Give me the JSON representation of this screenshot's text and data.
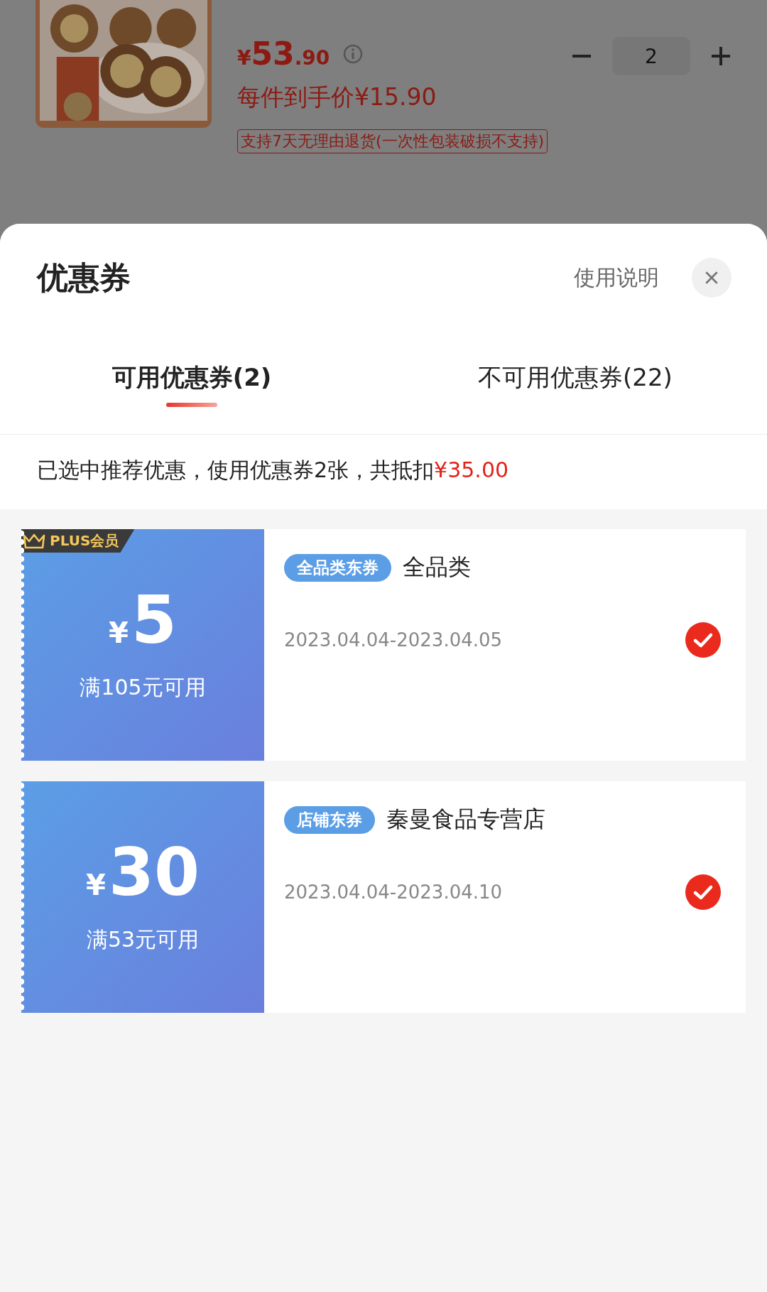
{
  "product": {
    "currency": "¥",
    "price_int": "53",
    "price_dec": ".90",
    "unit_price": "每件到手价¥15.90",
    "return_policy": "支持7天无理由退货(一次性包装破损不支持)",
    "quantity": "2"
  },
  "sheet": {
    "title": "优惠券",
    "help": "使用说明",
    "tabs": [
      {
        "label": "可用优惠券(2)",
        "selected": true
      },
      {
        "label": "不可用优惠券(22)",
        "selected": false
      }
    ],
    "summary": {
      "text": "已选中推荐优惠，使用优惠券2张，共抵扣",
      "amount": "¥35.00"
    },
    "coupons": [
      {
        "badge": "PLUS会员",
        "currency": "¥",
        "amount": "5",
        "condition": "满105元可用",
        "tag": "全品类东券",
        "scope": "全品类",
        "validity": "2023.04.04-2023.04.05",
        "checked": true
      },
      {
        "currency": "¥",
        "amount": "30",
        "condition": "满53元可用",
        "tag": "店铺东券",
        "scope": "秦曼食品专营店",
        "validity": "2023.04.04-2023.04.10",
        "checked": true
      }
    ]
  }
}
